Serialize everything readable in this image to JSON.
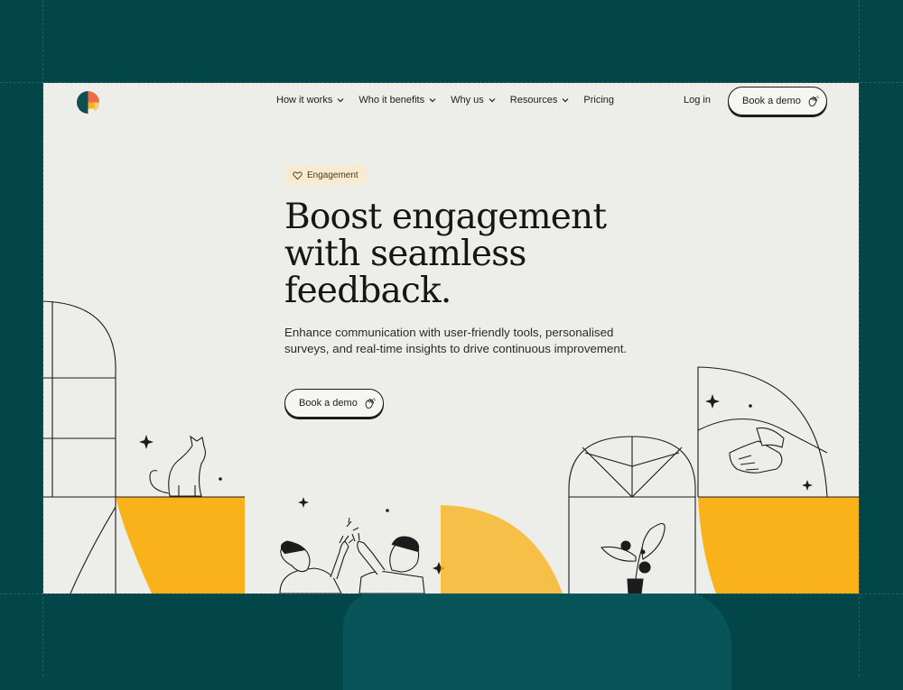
{
  "nav": {
    "items": [
      {
        "label": "How it works",
        "has_dropdown": true
      },
      {
        "label": "Who it benefits",
        "has_dropdown": true
      },
      {
        "label": "Why us",
        "has_dropdown": true
      },
      {
        "label": "Resources",
        "has_dropdown": true
      },
      {
        "label": "Pricing",
        "has_dropdown": false
      }
    ],
    "login_label": "Log in",
    "cta_label": "Book a demo"
  },
  "hero": {
    "tag": "Engagement",
    "title_line1": "Boost engagement",
    "title_line2": "with seamless",
    "title_line3": "feedback.",
    "subtitle": "Enhance communication with user-friendly tools, personalised surveys, and real-time insights to drive continuous improvement.",
    "cta_label": "Book a demo"
  },
  "icons": {
    "logo": "brand-logo",
    "tag": "heart-icon",
    "cta": "waving-hand-icon",
    "dropdown": "chevron-down-icon"
  },
  "colors": {
    "background": "#02464a",
    "page": "#ededea",
    "accent_yellow": "#f9b21a",
    "text": "#161616"
  }
}
